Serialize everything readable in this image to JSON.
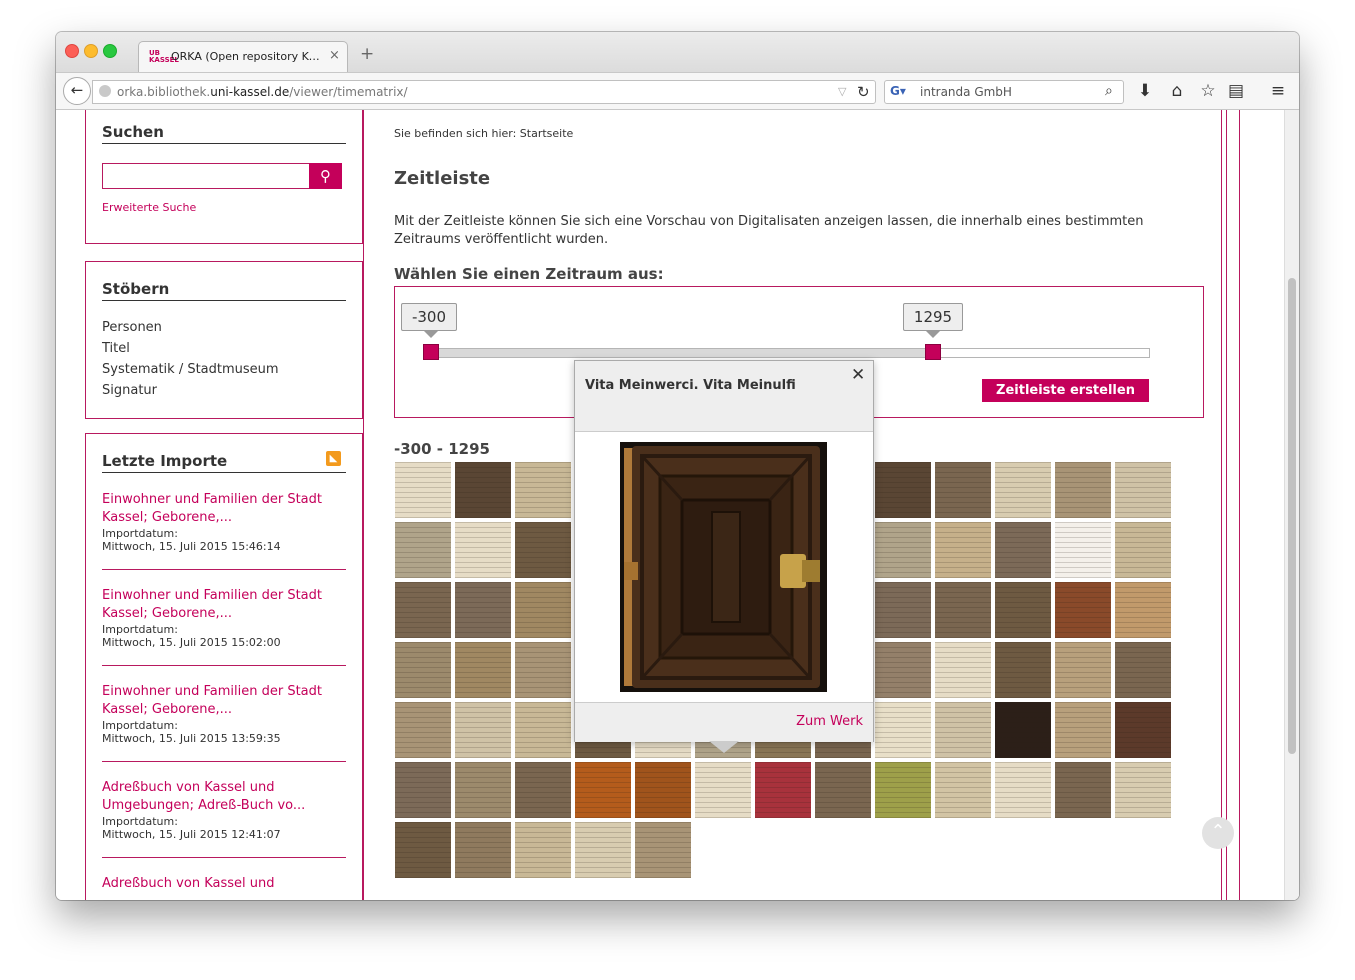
{
  "browser": {
    "tab_title": "ORKA (Open repository Kas…",
    "tab_favicon_text": "UB KASSEL",
    "url_prefix": "orka.bibliothek.",
    "url_domain": "uni-kassel.de",
    "url_path": "/viewer/timematrix/",
    "search_engine_label": "intranda GmbH",
    "icons": [
      "back-arrow-icon",
      "globe-icon",
      "reload-icon",
      "search-icon",
      "download-icon",
      "home-icon",
      "bookmark-star-icon",
      "reading-list-icon",
      "menu-icon"
    ]
  },
  "sidebar": {
    "search": {
      "title": "Suchen",
      "input_value": "",
      "advanced_link": "Erweiterte Suche"
    },
    "browse": {
      "title": "Stöbern",
      "items": [
        "Personen",
        "Titel",
        "Systematik / Stadtmuseum",
        "Signatur"
      ]
    },
    "imports": {
      "title": "Letzte Importe",
      "items": [
        {
          "title": "Einwohner und Familien der Stadt Kassel; Geborene,...",
          "label": "Importdatum:",
          "date": "Mittwoch, 15. Juli 2015 15:46:14"
        },
        {
          "title": "Einwohner und Familien der Stadt Kassel; Geborene,...",
          "label": "Importdatum:",
          "date": "Mittwoch, 15. Juli 2015 15:02:00"
        },
        {
          "title": "Einwohner und Familien der Stadt Kassel; Geborene,...",
          "label": "Importdatum:",
          "date": "Mittwoch, 15. Juli 2015 13:59:35"
        },
        {
          "title": "Adreßbuch von Kassel und Umgebungen; Adreß-Buch vo...",
          "label": "Importdatum:",
          "date": "Mittwoch, 15. Juli 2015 12:41:07"
        },
        {
          "title": "Adreßbuch von Kassel und",
          "label": "",
          "date": ""
        }
      ]
    }
  },
  "main": {
    "breadcrumb": "Sie befinden sich hier: Startseite",
    "title": "Zeitleiste",
    "intro": "Mit der Zeitleiste können Sie sich eine Vorschau von Digitalisaten anzeigen lassen, die innerhalb eines bestimmten Zeitraums veröffentlicht wurden.",
    "range_heading": "Wählen Sie einen Zeitraum aus:",
    "slider": {
      "min_label": "-300",
      "max_label": "1295",
      "min_fraction": 0.0,
      "max_fraction": 0.7
    },
    "create_button": "Zeitleiste erstellen",
    "result_range": "-300 - 1295"
  },
  "popup": {
    "title": "Vita Meinwerci. Vita Meinulfi",
    "link": "Zum Werk"
  },
  "colors": {
    "accent": "#c4005a",
    "border_accent": "#b8195f"
  }
}
